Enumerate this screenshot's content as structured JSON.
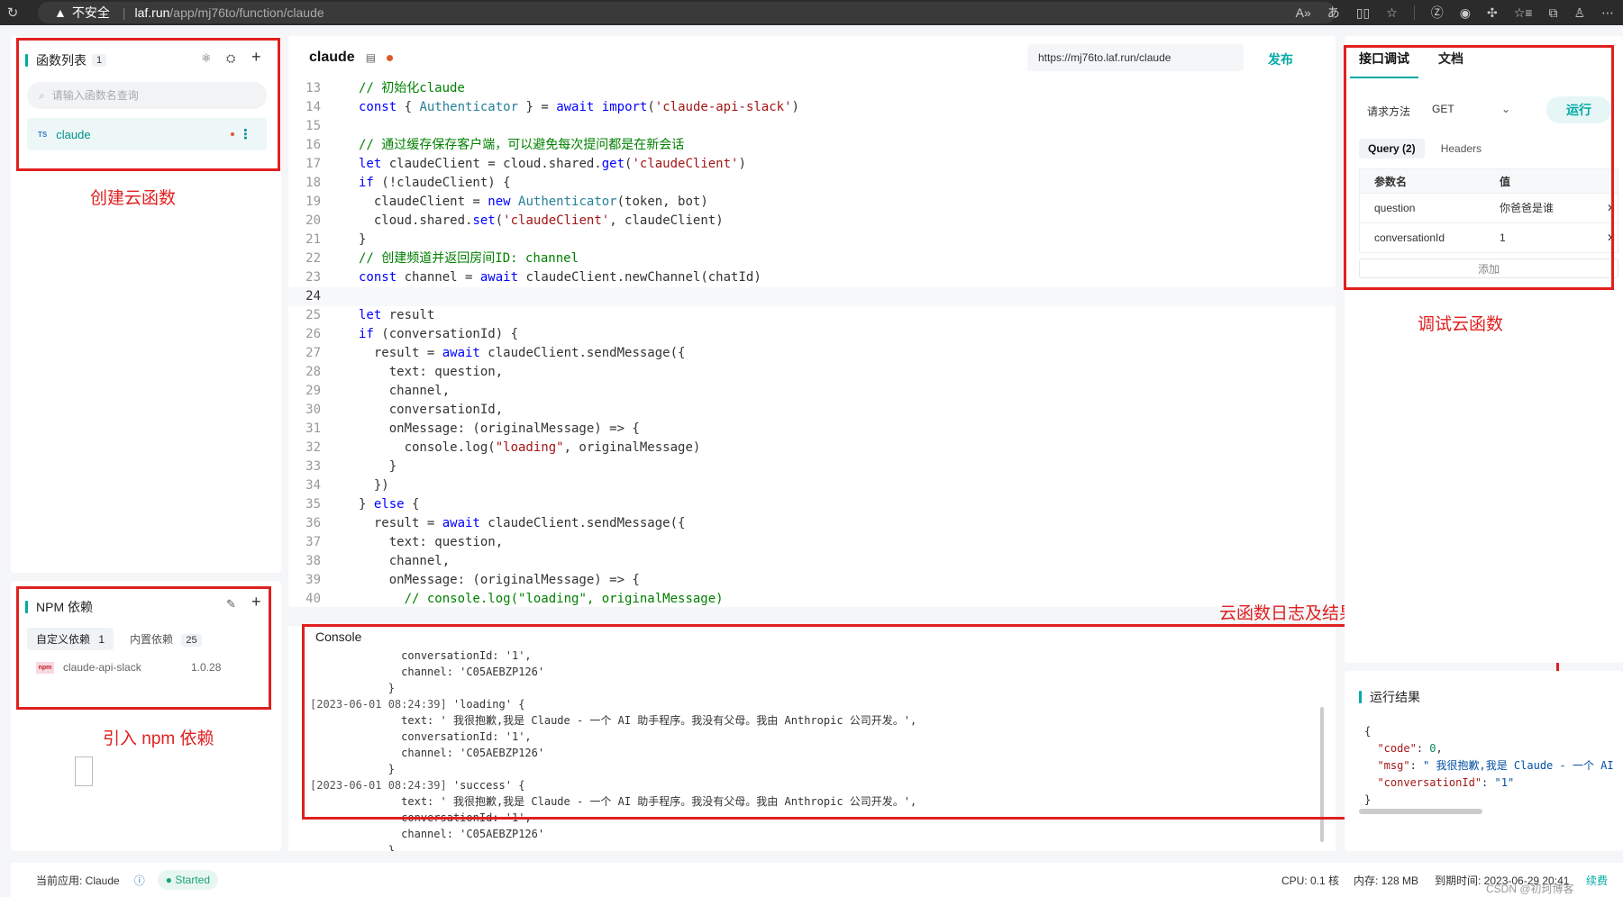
{
  "browser": {
    "warning": "不安全",
    "host": "laf.run",
    "path": "/app/mj76to/function/claude"
  },
  "functions": {
    "title": "函数列表",
    "count": "1",
    "search_placeholder": "请输入函数名查询",
    "items": [
      {
        "lang": "TS",
        "name": "claude"
      }
    ]
  },
  "npm": {
    "title": "NPM 依赖",
    "tab_custom": "自定义依赖",
    "tab_custom_count": "1",
    "tab_builtin": "内置依赖",
    "tab_builtin_count": "25",
    "packages": [
      {
        "name": "claude-api-slack",
        "version": "1.0.28"
      }
    ]
  },
  "editor": {
    "title": "claude",
    "url": "https://mj76to.laf.run/claude",
    "publish_label": "发布",
    "lines": [
      {
        "n": "13",
        "html": "<span class='c'>// 初始化claude</span>"
      },
      {
        "n": "14",
        "html": "<span class='k'>const</span> { <span class='t'>Authenticator</span> } = <span class='k'>await</span> <span class='k'>import</span>(<span class='s'>'claude-api-slack'</span>)"
      },
      {
        "n": "15",
        "html": ""
      },
      {
        "n": "16",
        "html": "<span class='c'>// 通过缓存保存客户端，可以避免每次提问都是在新会话</span>"
      },
      {
        "n": "17",
        "html": "<span class='k'>let</span> claudeClient = cloud.shared.<span class='k'>get</span>(<span class='s'>'claudeClient'</span>)"
      },
      {
        "n": "18",
        "html": "<span class='k'>if</span> (!claudeClient) {"
      },
      {
        "n": "19",
        "html": "  claudeClient = <span class='k'>new</span> <span class='t'>Authenticator</span>(token, bot)"
      },
      {
        "n": "20",
        "html": "  cloud.shared.<span class='k'>set</span>(<span class='s'>'claudeClient'</span>, claudeClient)"
      },
      {
        "n": "21",
        "html": "}"
      },
      {
        "n": "22",
        "html": "<span class='c'>// 创建频道并返回房间ID: channel</span>"
      },
      {
        "n": "23",
        "html": "<span class='k'>const</span> channel = <span class='k'>await</span> claudeClient.newChannel(chatId)"
      },
      {
        "n": "24",
        "html": "",
        "current": true
      },
      {
        "n": "25",
        "html": "<span class='k'>let</span> result"
      },
      {
        "n": "26",
        "html": "<span class='k'>if</span> (conversationId) {"
      },
      {
        "n": "27",
        "html": "  result = <span class='k'>await</span> claudeClient.sendMessage({"
      },
      {
        "n": "28",
        "html": "    text: question,"
      },
      {
        "n": "29",
        "html": "    channel,"
      },
      {
        "n": "30",
        "html": "    conversationId,"
      },
      {
        "n": "31",
        "html": "    onMessage: (originalMessage) => {"
      },
      {
        "n": "32",
        "html": "      console.log(<span class='s'>\"loading\"</span>, originalMessage)"
      },
      {
        "n": "33",
        "html": "    }"
      },
      {
        "n": "34",
        "html": "  })"
      },
      {
        "n": "35",
        "html": "} <span class='k'>else</span> {"
      },
      {
        "n": "36",
        "html": "  result = <span class='k'>await</span> claudeClient.sendMessage({"
      },
      {
        "n": "37",
        "html": "    text: question,"
      },
      {
        "n": "38",
        "html": "    channel,"
      },
      {
        "n": "39",
        "html": "    onMessage: (originalMessage) => {"
      },
      {
        "n": "40",
        "html": "      <span class='c'>// console.log(\"loading\", originalMessage)</span>"
      }
    ]
  },
  "console": {
    "title": "Console",
    "lines": [
      {
        "ts": "",
        "text": "              conversationId: '1',"
      },
      {
        "ts": "",
        "text": "              channel: 'C05AEBZP126'"
      },
      {
        "ts": "",
        "text": "            }"
      },
      {
        "ts": "[2023-06-01 08:24:39]",
        "text": " 'loading' {"
      },
      {
        "ts": "",
        "text": "              text: ' 我很抱歉,我是 Claude - 一个 AI 助手程序。我没有父母。我由 Anthropic 公司开发。',"
      },
      {
        "ts": "",
        "text": "              conversationId: '1',"
      },
      {
        "ts": "",
        "text": "              channel: 'C05AEBZP126'"
      },
      {
        "ts": "",
        "text": "            }"
      },
      {
        "ts": "[2023-06-01 08:24:39]",
        "text": " 'success' {"
      },
      {
        "ts": "",
        "text": "              text: ' 我很抱歉,我是 Claude - 一个 AI 助手程序。我没有父母。我由 Anthropic 公司开发。',"
      },
      {
        "ts": "",
        "text": "              conversationId: '1',"
      },
      {
        "ts": "",
        "text": "              channel: 'C05AEBZP126'"
      },
      {
        "ts": "",
        "text": "            }"
      }
    ]
  },
  "debug": {
    "tab_api": "接口调试",
    "tab_docs": "文档",
    "method_label": "请求方法",
    "method_value": "GET",
    "run_label": "运行",
    "tab_query": "Query (2)",
    "tab_headers": "Headers",
    "col_name": "参数名",
    "col_value": "值",
    "params": [
      {
        "name": "question",
        "value": "你爸爸是谁"
      },
      {
        "name": "conversationId",
        "value": "1"
      }
    ],
    "add_label": "添加"
  },
  "result": {
    "title": "运行结果",
    "lines": [
      "{",
      "  <span style='color:#a31515'>\"code\"</span>: <span style='color:#098658'>0</span>,",
      "  <span style='color:#a31515'>\"msg\"</span>: <span style='color:#0451a5'>\" 我很抱歉,我是 Claude - 一个 AI</span>",
      "  <span style='color:#a31515'>\"conversationId\"</span>: <span style='color:#0451a5'>\"1\"</span>",
      "}"
    ]
  },
  "annotations": {
    "create": "创建云函数",
    "npm": "引入 npm 依赖",
    "debug": "调试云函数",
    "logs": "云函数日志及结果输出"
  },
  "status": {
    "app_label": "当前应用: Claude",
    "state": "Started",
    "cpu": "CPU: 0.1 核",
    "memory": "内存: 128 MB",
    "expiry": "到期时间: 2023-06-29 20:41",
    "renew": "续费",
    "watermark": "CSDN @初珂博客"
  },
  "colors": {
    "accent": "#00a9a6",
    "annotation": "#e02020"
  }
}
